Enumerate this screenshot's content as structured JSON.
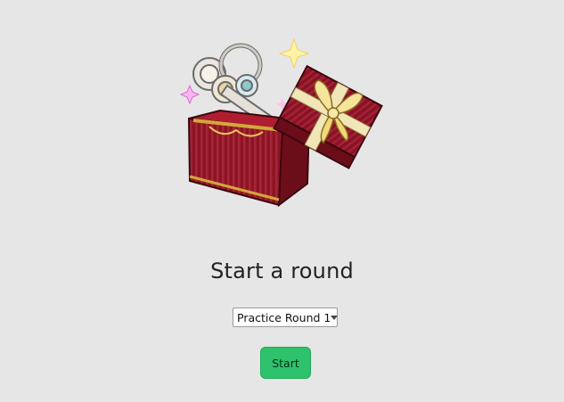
{
  "heading": "Start a round",
  "round_select": {
    "selected": "Practice Round 1"
  },
  "start_label": "Start",
  "colors": {
    "background": "#e6e6e6",
    "button": "#2dc26b",
    "box_red": "#8e1423",
    "ribbon": "#f1e6b8",
    "gold": "#d4a73b"
  },
  "image": {
    "icon": "gift-box-icon"
  }
}
